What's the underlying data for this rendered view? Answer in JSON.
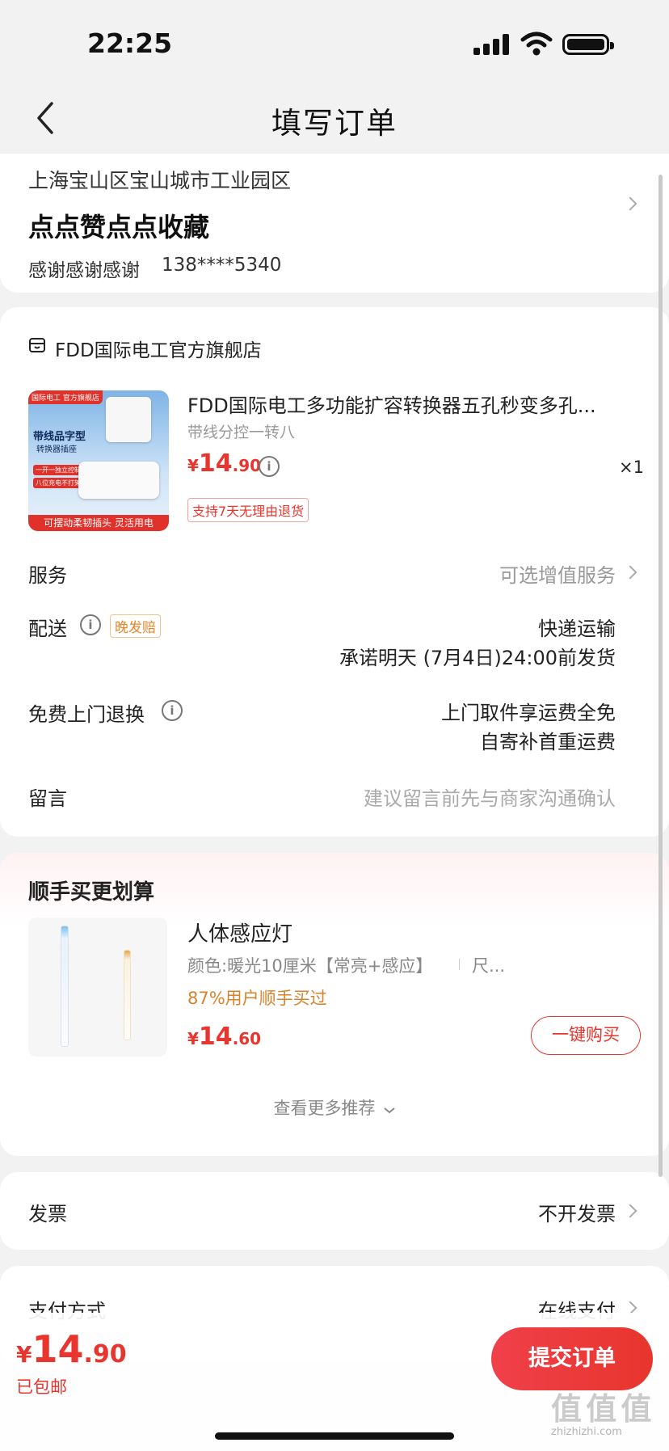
{
  "status_bar": {
    "time": "22:25"
  },
  "header": {
    "title": "填写订单"
  },
  "address": {
    "region": "上海宝山区宝山城市工业园区",
    "detail": "点点赞点点收藏",
    "recipient": "感谢感谢感谢",
    "phone": "138****5340"
  },
  "store": {
    "name": "FDD国际电工官方旗舰店",
    "product": {
      "title": "FDD国际电工多功能扩容转换器五孔秒变多孔...",
      "spec": "带线分控一转八",
      "currency": "¥",
      "price_int": "14",
      "price_dec": ".90",
      "qty": "×1",
      "return_badge": "支持7天无理由退货",
      "image": {
        "brand_tag": "国际电工 官方旗舰店",
        "line1": "带线品字型",
        "line2": "转换器插座",
        "tag1": "一开一独立控制",
        "tag2": "八位充电不打架",
        "banner": "可摆动柔韧插头 灵活用电"
      }
    },
    "service": {
      "label": "服务",
      "value": "可选增值服务"
    },
    "delivery": {
      "label": "配送",
      "badge": "晚发赔",
      "method": "快递运输",
      "promise": "承诺明天 (7月4日)24:00前发货"
    },
    "return_exchange": {
      "label": "免费上门退换",
      "line1": "上门取件享运费全免",
      "line2": "自寄补首重运费"
    },
    "message": {
      "label": "留言",
      "placeholder": "建议留言前先与商家沟通确认"
    }
  },
  "recommend": {
    "title": "顺手买更划算",
    "item": {
      "name": "人体感应灯",
      "spec": "颜色:暖光10厘米【常亮+感应】",
      "spec_more": "尺...",
      "social": "87%用户顺手买过",
      "currency": "¥",
      "price_int": "14",
      "price_dec": ".60",
      "buy_label": "一键购买"
    },
    "more_label": "查看更多推荐"
  },
  "invoice": {
    "label": "发票",
    "value": "不开发票"
  },
  "payment": {
    "label": "支付方式",
    "value": "在线支付"
  },
  "footer": {
    "currency": "¥",
    "total_int": "14",
    "total_dec": ".90",
    "shipping": "已包邮",
    "submit_label": "提交订单"
  },
  "watermark": {
    "text": "值 值 值",
    "sub": "zhizhizhi.com"
  },
  "colors": {
    "accent": "#e8352d",
    "badge_orange": "#e8872b",
    "social_orange": "#d9822b"
  }
}
